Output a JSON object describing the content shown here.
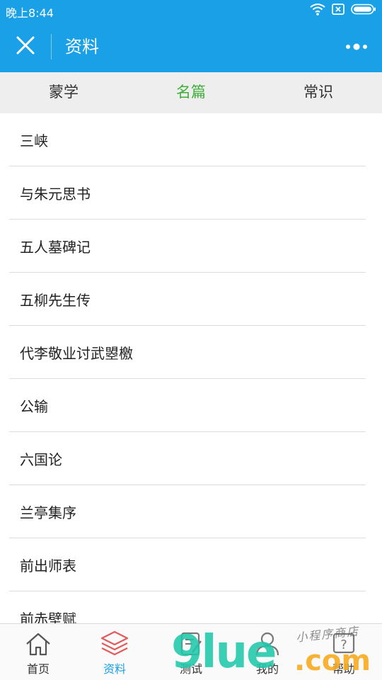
{
  "status_bar": {
    "time": "晚上8:44",
    "icons": [
      "wifi-icon",
      "sim-missing-icon",
      "battery-icon"
    ]
  },
  "nav": {
    "title": "资料",
    "close_icon": "close-icon",
    "more_icon": "more-dots-icon"
  },
  "colors": {
    "primary": "#1aa0e6",
    "active_tab": "#3fae3a",
    "active_tabbar": "#1aa0e6",
    "active_icon": "#e25b5b"
  },
  "tabs": [
    {
      "label": "蒙学",
      "active": false
    },
    {
      "label": "名篇",
      "active": true
    },
    {
      "label": "常识",
      "active": false
    }
  ],
  "list": [
    "三峡",
    "与朱元思书",
    "五人墓碑记",
    "五柳先生传",
    "代李敬业讨武曌檄",
    "公输",
    "六国论",
    "兰亭集序",
    "前出师表",
    "前赤壁赋"
  ],
  "tabbar": [
    {
      "label": "首页",
      "icon": "home-icon",
      "active": false
    },
    {
      "label": "资料",
      "icon": "layers-icon",
      "active": true
    },
    {
      "label": "测试",
      "icon": "test-icon",
      "active": false
    },
    {
      "label": "我的",
      "icon": "user-icon",
      "active": false
    },
    {
      "label": "帮助",
      "icon": "help-icon",
      "active": false
    }
  ],
  "watermark": {
    "main": "9lue",
    "suffix": ".com",
    "sub": "小程序商店"
  }
}
